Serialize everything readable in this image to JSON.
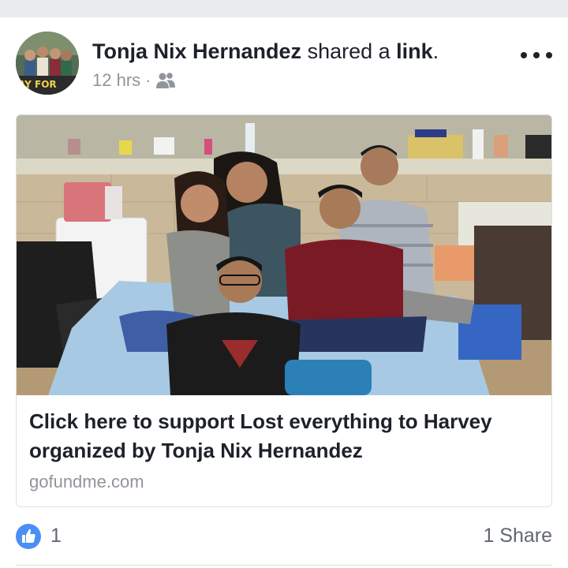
{
  "post": {
    "author": "Tonja Nix Hernandez",
    "action_text": "shared a",
    "action_object": "link",
    "action_end": ".",
    "time": "12 hrs",
    "separator": "·",
    "audience_icon": "friends-icon",
    "more_icon": "more-options-icon",
    "avatar_text": "AY FOR"
  },
  "link": {
    "title": "Click here to support Lost everything to Harvey organized by Tonja Nix Hernandez",
    "domain": "gofundme.com"
  },
  "reactions": {
    "like_icon": "like-thumb-icon",
    "like_count": "1",
    "share_count": "1 Share"
  },
  "colors": {
    "like_blue": "#4b8ff5",
    "meta_gray": "#90949c",
    "text": "#1d2129",
    "divider": "#dddfe2"
  }
}
